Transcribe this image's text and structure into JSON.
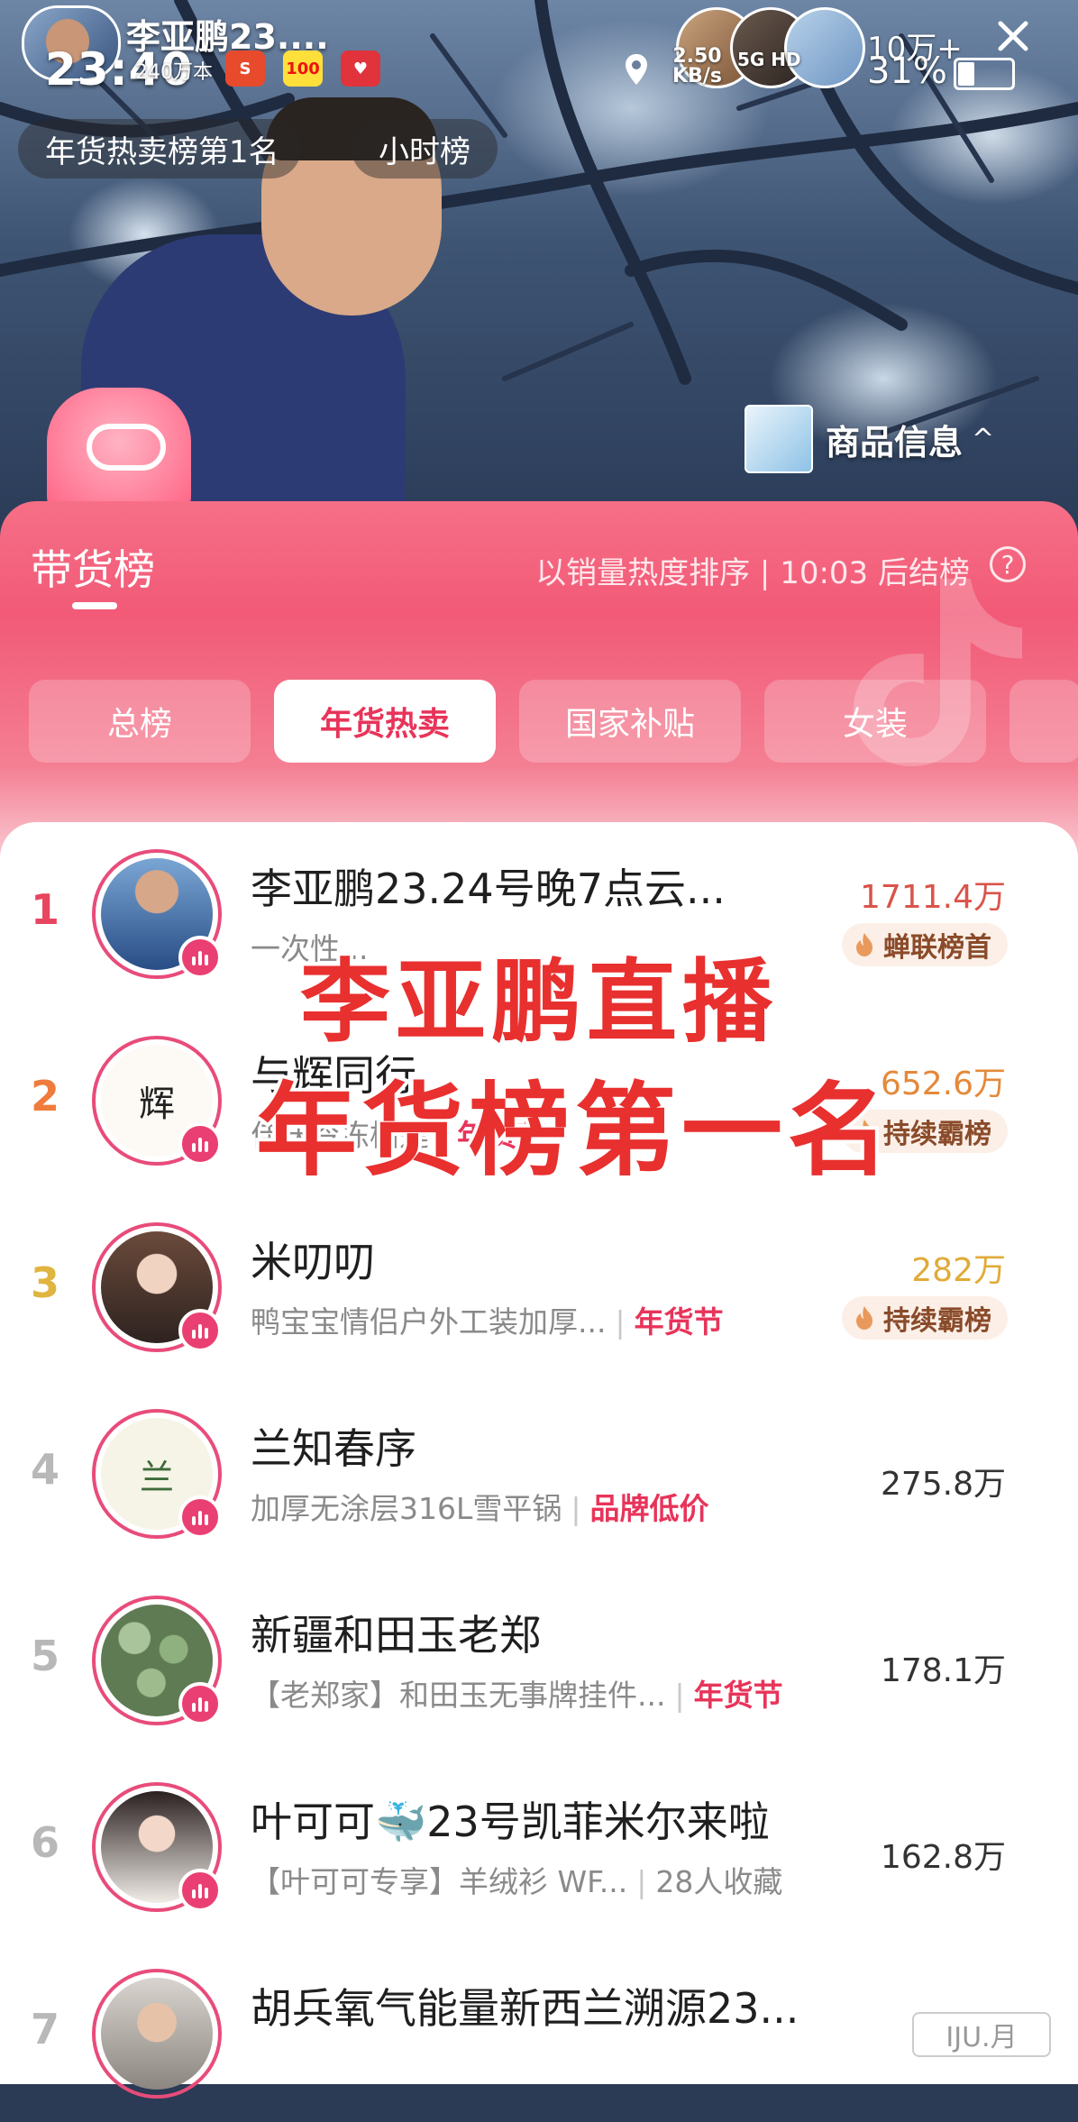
{
  "stream": {
    "streamer_name": "李亚鹏23....",
    "follower_count": "240万本",
    "rank_chip": "年货热卖榜第1名",
    "hourly_chip": "小时榜",
    "product_info_label": "商品信息",
    "product_chevron": "^"
  },
  "status_bar": {
    "time": "23:40",
    "net_speed_value": "2.50",
    "net_speed_unit": "KB/s",
    "signal": "5G HD",
    "viewer_count": "10万+",
    "battery": "31%",
    "notif_icons": [
      "S",
      "100",
      "♥"
    ]
  },
  "panel": {
    "title": "带货榜",
    "subtitle": "以销量热度排序 | 10:03 后结榜",
    "help_symbol": "?",
    "tabs": [
      {
        "label": "总榜",
        "active": false
      },
      {
        "label": "年货热卖",
        "active": true
      },
      {
        "label": "国家补贴",
        "active": false
      },
      {
        "label": "女装",
        "active": false
      },
      {
        "label": "",
        "active": false
      }
    ]
  },
  "rows": [
    {
      "rank": "1",
      "name": "李亚鹏23.24号晚7点云...",
      "sub": "一次性...",
      "tag": "",
      "value": "1711.4万",
      "badge": "蝉联榜首"
    },
    {
      "rank": "2",
      "name": "与辉同行",
      "sub": "佳沃冷冻榴莲",
      "tag": "年货节",
      "value": "652.6万",
      "badge": "持续霸榜"
    },
    {
      "rank": "3",
      "name": "米叨叨",
      "sub": "鸭宝宝情侣户外工装加厚...",
      "tag": "年货节",
      "value": "282万",
      "badge": "持续霸榜"
    },
    {
      "rank": "4",
      "name": "兰知春序",
      "sub": "加厚无涂层316L雪平锅",
      "tag": "品牌低价",
      "value": "275.8万",
      "badge": ""
    },
    {
      "rank": "5",
      "name": "新疆和田玉老郑",
      "sub": "【老郑家】和田玉无事牌挂件...",
      "tag": "年货节",
      "value": "178.1万",
      "badge": ""
    },
    {
      "rank": "6",
      "name": "叶可可🐳23号凯菲米尔来啦",
      "sub": "【叶可可专享】羊绒衫 WF...",
      "tag": "28人收藏",
      "value": "162.8万",
      "badge": ""
    },
    {
      "rank": "7",
      "name": "胡兵氧气能量新西兰溯源23...",
      "sub": "",
      "tag": "",
      "value": "",
      "badge": ""
    }
  ],
  "overlay": {
    "line1": "李亚鹏直播",
    "line2": "年货榜第一名"
  },
  "source_watermark": "IJU.月",
  "colors": {
    "accent": "#e8345a",
    "panel_top": "#f25a77",
    "rank1": "#e8455f",
    "rank2": "#ef7c3c",
    "rank3": "#e0b440",
    "caption": "#e8302f"
  }
}
